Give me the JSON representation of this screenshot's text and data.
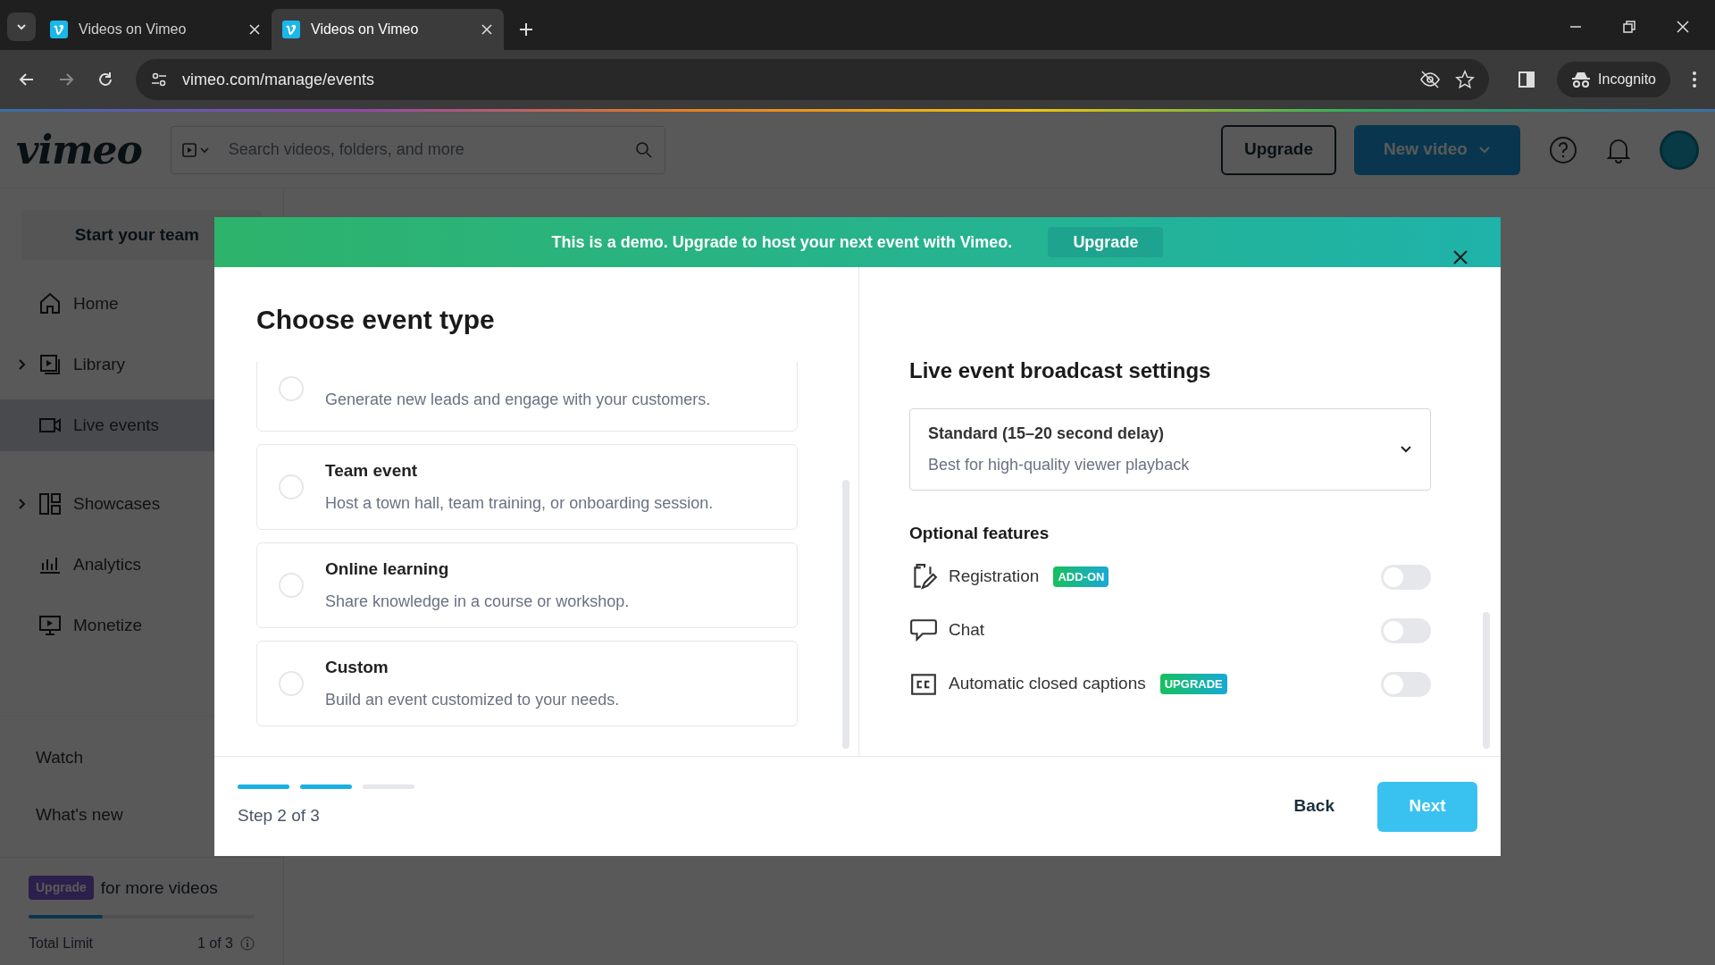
{
  "browser": {
    "tabs": [
      {
        "title": "Videos on Vimeo",
        "selected": false
      },
      {
        "title": "Videos on Vimeo",
        "selected": true
      }
    ],
    "url": "vimeo.com/manage/events",
    "profile": "Incognito"
  },
  "header": {
    "logo": "vimeo",
    "search": {
      "placeholder": "Search videos, folders, and more"
    },
    "upgrade": "Upgrade",
    "new_video": "New video"
  },
  "sidebar": {
    "team_button": "Start your team",
    "items": [
      {
        "label": "Home",
        "kind": "link",
        "selected": false
      },
      {
        "label": "Library",
        "kind": "group",
        "selected": false
      },
      {
        "label": "Live events",
        "kind": "link",
        "selected": true
      },
      {
        "label": "Showcases",
        "kind": "group",
        "selected": false
      },
      {
        "label": "Analytics",
        "kind": "link",
        "selected": false
      },
      {
        "label": "Monetize",
        "kind": "link",
        "selected": false
      }
    ],
    "footer_links": [
      "Watch",
      "What's new"
    ],
    "upgrade_badge": "Upgrade",
    "upgrade_text": "for more videos",
    "limit": {
      "label": "Total Limit",
      "value": "1 of 3",
      "level": 0.33
    }
  },
  "modal": {
    "banner": {
      "text": "This is a demo. Upgrade to host your next event with Vimeo.",
      "button": "Upgrade"
    },
    "title": "Choose event type",
    "event_types": [
      {
        "description": "Generate new leads and engage with your customers.",
        "selected": false
      },
      {
        "title": "Team event",
        "description": "Host a town hall, team training, or onboarding session.",
        "selected": false
      },
      {
        "title": "Online learning",
        "description": "Share knowledge in a course or workshop.",
        "selected": false
      },
      {
        "title": "Custom",
        "description": "Build an event customized to your needs.",
        "selected": false
      }
    ],
    "settings": {
      "title": "Live event broadcast settings",
      "latency": {
        "value": "Standard (15–20 second delay)",
        "description": "Best for high-quality viewer playback"
      },
      "features_title": "Optional features",
      "features": [
        {
          "label": "Registration",
          "badge": "ADD-ON",
          "on": false
        },
        {
          "label": "Chat",
          "on": false
        },
        {
          "label": "Automatic closed captions",
          "badge": "UPGRADE",
          "on": false
        }
      ]
    },
    "steps": [
      {
        "complete": true
      },
      {
        "complete": true
      },
      {
        "complete": false
      }
    ],
    "step_text": "Step 2 of 3",
    "back": "Back",
    "next": "Next"
  }
}
